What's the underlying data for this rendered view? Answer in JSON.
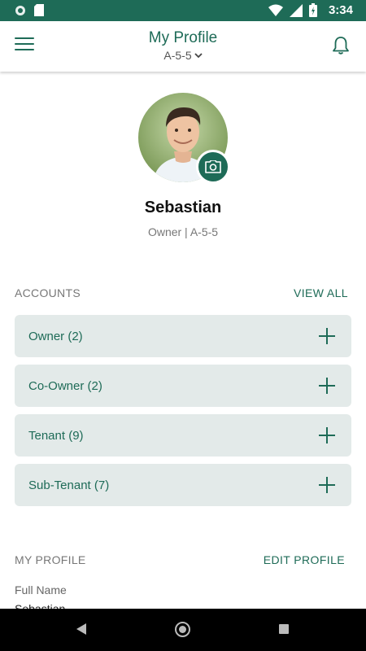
{
  "status_bar": {
    "time": "3:34"
  },
  "app_bar": {
    "title": "My Profile",
    "unit": "A-5-5"
  },
  "profile": {
    "name": "Sebastian",
    "role": "Owner | A-5-5"
  },
  "accounts": {
    "title": "ACCOUNTS",
    "action": "VIEW ALL",
    "items": [
      {
        "label": "Owner (2)"
      },
      {
        "label": "Co-Owner (2)"
      },
      {
        "label": "Tenant (9)"
      },
      {
        "label": "Sub-Tenant (7)"
      }
    ]
  },
  "my_profile": {
    "title": "MY PROFILE",
    "action": "EDIT PROFILE",
    "fields": [
      {
        "label": "Full Name",
        "value": "Sebastian"
      }
    ]
  },
  "colors": {
    "primary": "#1e6b57",
    "card_bg": "#e3eae9"
  }
}
